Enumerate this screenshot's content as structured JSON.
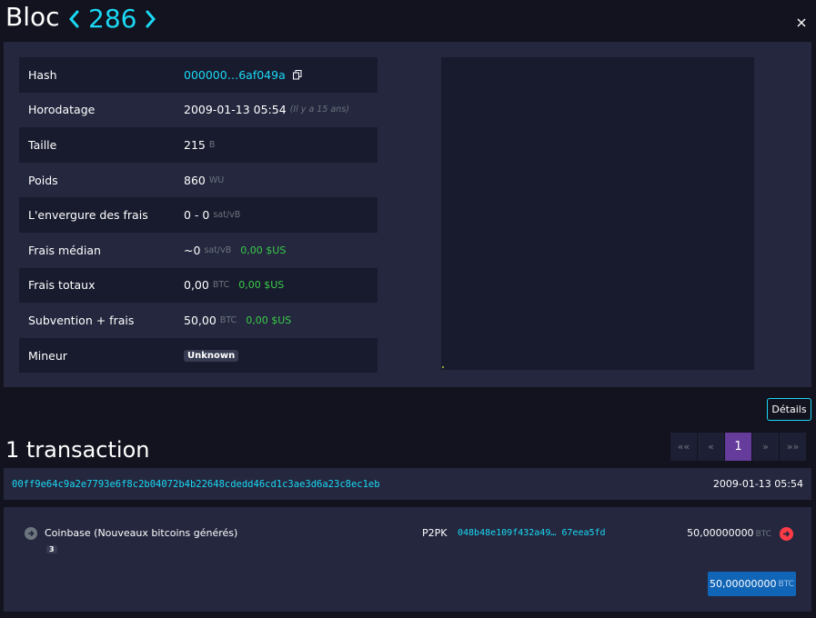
{
  "header": {
    "title": "Bloc",
    "height": "286",
    "prev_icon": "chevron-left-icon",
    "next_icon": "chevron-right-icon",
    "close_icon": "close-icon"
  },
  "block": {
    "rows": [
      {
        "label": "Hash",
        "value": "000000…6af049a"
      },
      {
        "label": "Horodatage",
        "value": "2009-01-13 05:54",
        "note": "(Il y a 15 ans)"
      },
      {
        "label": "Taille",
        "value": "215",
        "unit": "B"
      },
      {
        "label": "Poids",
        "value": "860",
        "unit": "WU"
      },
      {
        "label": "L'envergure des frais",
        "value": "0 - 0",
        "unit": "sat/vB"
      },
      {
        "label": "Frais médian",
        "value": "~0",
        "unit": "sat/vB",
        "fiat": "0,00 $US"
      },
      {
        "label": "Frais totaux",
        "value": "0,00",
        "unit": "BTC",
        "fiat": "0,00 $US"
      },
      {
        "label": "Subvention + frais",
        "value": "50,00",
        "unit": "BTC",
        "fiat": "0,00 $US"
      },
      {
        "label": "Mineur",
        "value": "Unknown"
      }
    ],
    "copy_icon": "copy-icon"
  },
  "details_button": "Détails",
  "transactions": {
    "count_label": "1 transaction",
    "pagination": [
      "««",
      "«",
      "1",
      "»",
      "»»"
    ],
    "active_page": "1",
    "items": [
      {
        "txid": "00ff9e64c9a2e7793e6f8c2b04072b4b22648cdedd46cd1c3ae3d6a23c8ec1eb",
        "time": "2009-01-13 05:54",
        "input": "Coinbase (Nouveaux bitcoins générés)",
        "input_badge": "3",
        "script_type": "P2PK",
        "output_address": "048b48e109f432a49… 67eea5fd",
        "output_amount": "50,00000000",
        "unit": "BTC",
        "total": "50,00000000"
      }
    ]
  },
  "colors": {
    "accent": "#1bd8f4",
    "background": "#12131e",
    "panel": "#24273e",
    "row_alt": "#181b2e",
    "fiat_green": "#3bcc49",
    "pager_active": "#653b9c",
    "total_button": "#1165b6",
    "output_arrow": "#ff3b48"
  }
}
